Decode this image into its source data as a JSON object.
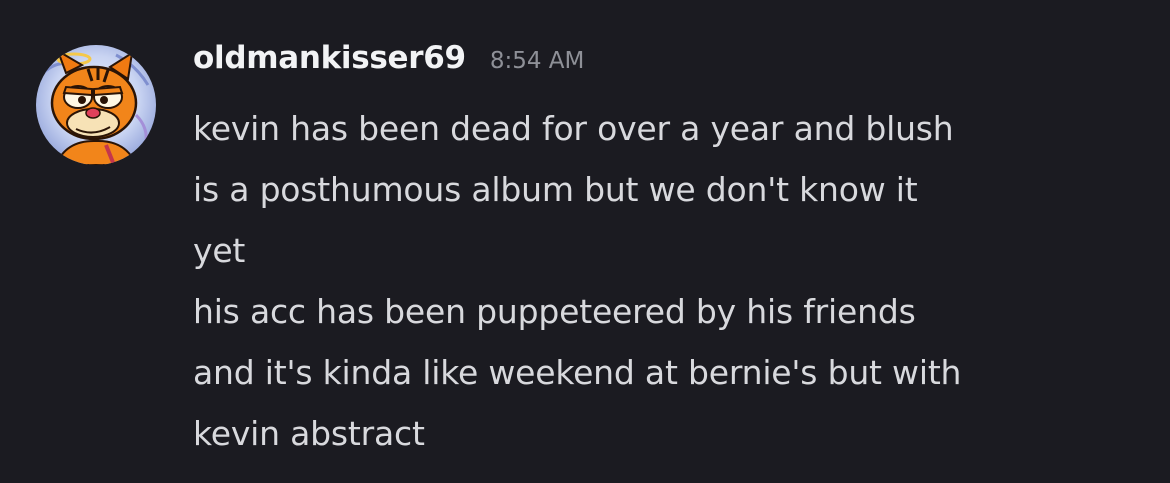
{
  "message": {
    "username": "oldmankisser69",
    "timestamp": "8:54 AM",
    "lines": [
      "kevin has been dead for over a year and blush",
      "is a posthumous album but we don't know it",
      "yet",
      "his acc has been puppeteered by his friends",
      "and it's kinda like weekend at bernie's but with",
      "kevin abstract"
    ],
    "avatar_icon": "garfield-avatar-icon"
  },
  "colors": {
    "background": "#1b1b21",
    "username": "#f2f3f5",
    "timestamp": "#8e9097",
    "text": "#d8d9dd"
  }
}
